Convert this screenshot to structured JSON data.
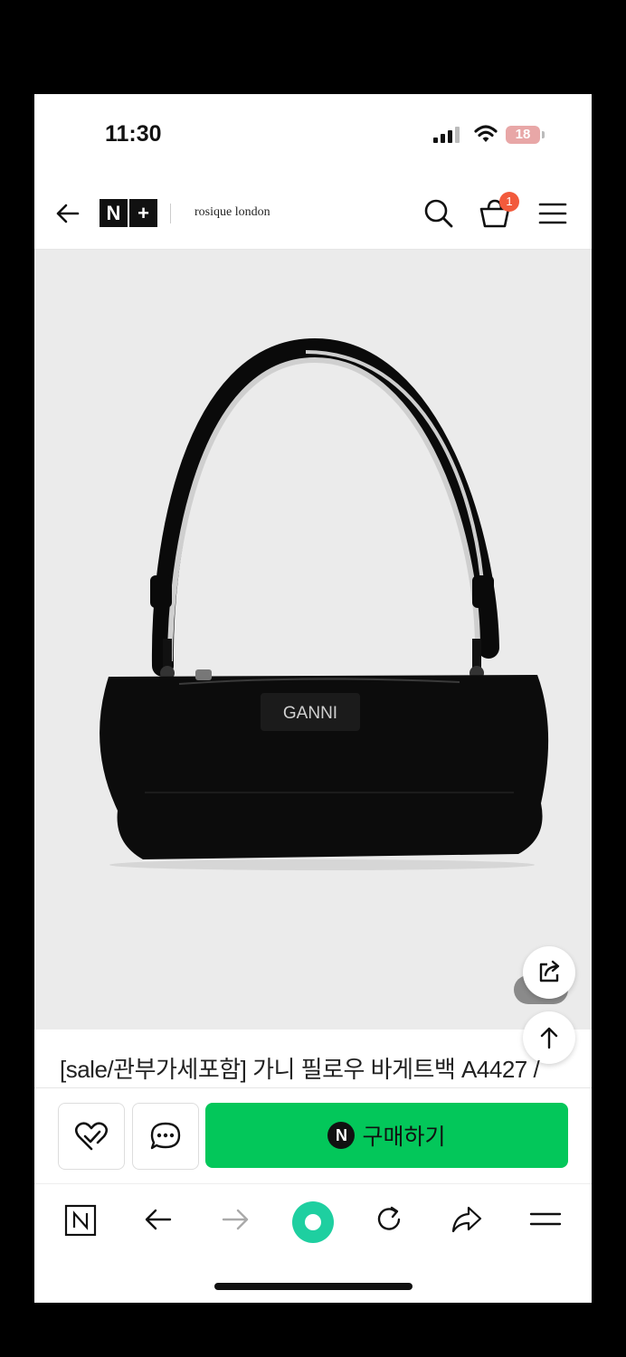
{
  "status_bar": {
    "time": "11:30",
    "battery": "18"
  },
  "header": {
    "logo_left": "N",
    "logo_right": "+",
    "shop_name": "rosique london",
    "cart_count": "1"
  },
  "product": {
    "brand_on_bag": "GANNI",
    "title": "[sale/관부가세포함] 가니 필로우 바게트백 A4427 /"
  },
  "actions": {
    "buy_badge": "N",
    "buy_label": "구매하기"
  },
  "colors": {
    "accent": "#03c75a",
    "badge": "#f25a3c"
  },
  "icons": [
    "back-arrow-icon",
    "search-icon",
    "cart-icon",
    "menu-icon",
    "share-icon",
    "arrow-up-icon",
    "heart-check-icon",
    "chat-icon",
    "naver-n-icon",
    "arrow-left-icon",
    "arrow-right-icon",
    "home-circle-icon",
    "refresh-icon",
    "forward-share-icon",
    "hamburger-icon"
  ]
}
